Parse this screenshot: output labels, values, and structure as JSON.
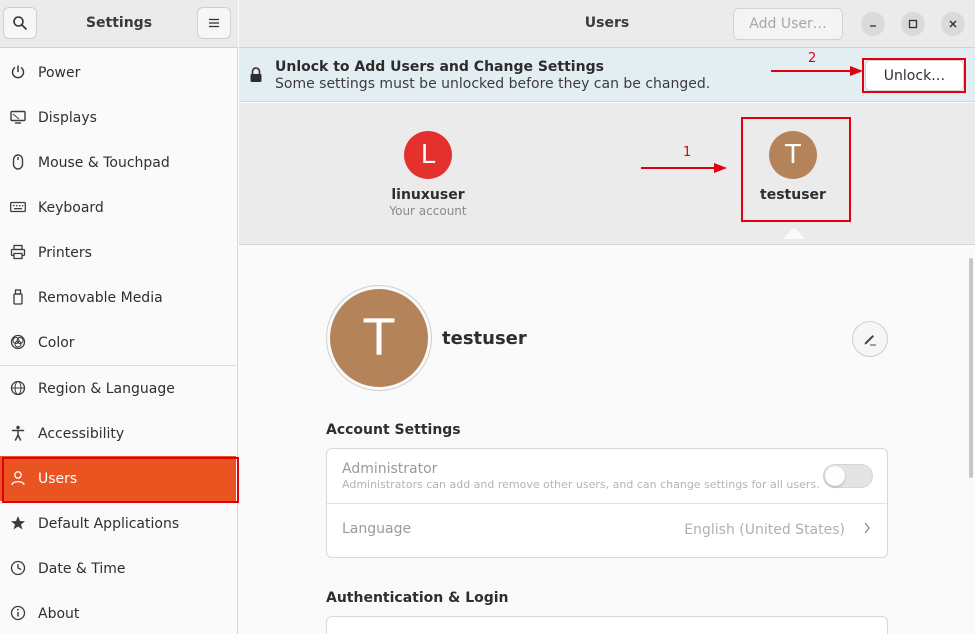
{
  "sidebar": {
    "title": "Settings",
    "items": [
      {
        "label": "Power",
        "icon": "power-icon"
      },
      {
        "label": "Displays",
        "icon": "display-icon"
      },
      {
        "label": "Mouse & Touchpad",
        "icon": "mouse-icon"
      },
      {
        "label": "Keyboard",
        "icon": "keyboard-icon"
      },
      {
        "label": "Printers",
        "icon": "printer-icon"
      },
      {
        "label": "Removable Media",
        "icon": "usb-icon"
      },
      {
        "label": "Color",
        "icon": "color-icon"
      },
      {
        "label": "Region & Language",
        "icon": "globe-icon"
      },
      {
        "label": "Accessibility",
        "icon": "accessibility-icon"
      },
      {
        "label": "Users",
        "icon": "user-icon",
        "active": true
      },
      {
        "label": "Default Applications",
        "icon": "star-icon"
      },
      {
        "label": "Date & Time",
        "icon": "clock-icon"
      },
      {
        "label": "About",
        "icon": "info-icon"
      }
    ]
  },
  "header": {
    "title": "Users",
    "add_user_label": "Add User…"
  },
  "banner": {
    "title": "Unlock to Add Users and Change Settings",
    "subtitle": "Some settings must be unlocked before they can be changed.",
    "unlock_label": "Unlock…"
  },
  "users": [
    {
      "initial": "L",
      "name": "linuxuser",
      "sub": "Your account",
      "color": "#e5312e"
    },
    {
      "initial": "T",
      "name": "testuser",
      "sub": "",
      "color": "#b5835a"
    }
  ],
  "selected_user": {
    "initial": "T",
    "name": "testuser"
  },
  "account_settings": {
    "heading": "Account Settings",
    "administrator_label": "Administrator",
    "administrator_sub": "Administrators can add and remove other users, and can change settings for all users.",
    "administrator_enabled": false,
    "language_label": "Language",
    "language_value": "English (United States)"
  },
  "auth": {
    "heading": "Authentication & Login"
  },
  "annotations": {
    "arrow1_label": "1",
    "arrow2_label": "2",
    "color": "#e0000f"
  },
  "colors": {
    "accent": "#e95420"
  }
}
